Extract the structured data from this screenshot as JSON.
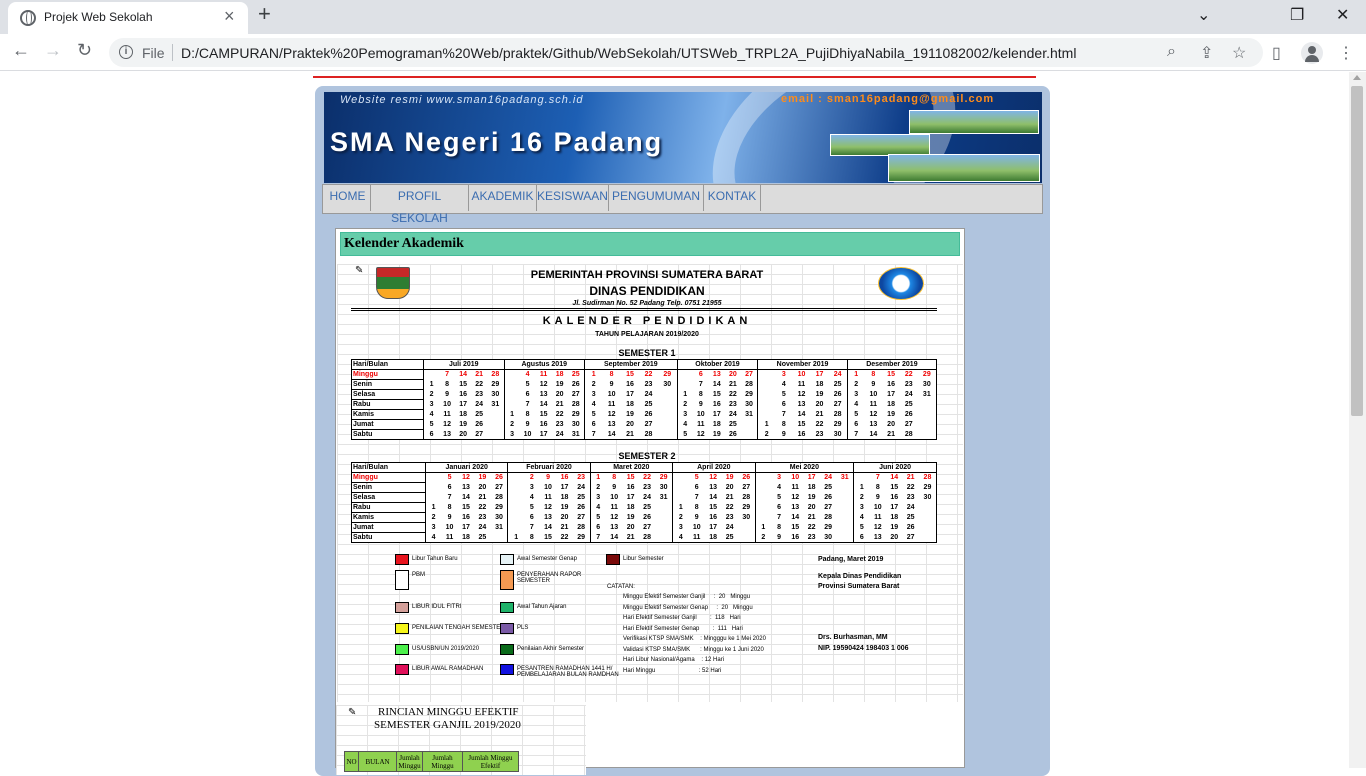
{
  "browser": {
    "tab_title": "Projek Web Sekolah",
    "file_label": "File",
    "url": "D:/CAMPURAN/Praktek%20Pemograman%20Web/praktek/Github/WebSekolah/UTSWeb_TRPL2A_PujiDhiyaNabila_1911082002/kelender.html"
  },
  "site": {
    "banner_web": "Website resmi www.sman16padang.sch.id",
    "banner_email": "email : sman16padang@gmail.com",
    "banner_school": "SMA Negeri 16 Padang",
    "menu": [
      "HOME",
      "PROFIL SEKOLAH",
      "AKADEMIK",
      "KESISWAAN",
      "PENGUMUMAN",
      "KONTAK"
    ],
    "section_heading": "Kelender Akademik"
  },
  "calendar": {
    "gov": "PEMERINTAH PROVINSI SUMATERA BARAT",
    "dept": "DINAS PENDIDIKAN",
    "address": "Jl. Sudirman No. 52 Padang Telp. 0751 21955",
    "title": "KALENDER PENDIDIKAN",
    "year": "TAHUN PELAJARAN 2019/2020",
    "day_col": "Hari/Bulan",
    "days": [
      "Minggu",
      "Senin",
      "Selasa",
      "Rabu",
      "Kamis",
      "Jumat",
      "Sabtu"
    ],
    "sem1": {
      "title": "SEMESTER 1",
      "months": [
        {
          "name": "Juli 2019",
          "cols": [
            [
              "",
              "1",
              "2",
              "3",
              "4",
              "5",
              "6"
            ],
            [
              "7",
              "8",
              "9",
              "10",
              "11",
              "12",
              "13"
            ],
            [
              "14",
              "15",
              "16",
              "17",
              "18",
              "19",
              "20"
            ],
            [
              "21",
              "22",
              "23",
              "24",
              "25",
              "26",
              "27"
            ],
            [
              "28",
              "29",
              "30",
              "31",
              "",
              "",
              ""
            ]
          ]
        },
        {
          "name": "Agustus 2019",
          "cols": [
            [
              "",
              "",
              "",
              "",
              "1",
              "2",
              "3"
            ],
            [
              "4",
              "5",
              "6",
              "7",
              "8",
              "9",
              "10"
            ],
            [
              "11",
              "12",
              "13",
              "14",
              "15",
              "16",
              "17"
            ],
            [
              "18",
              "19",
              "20",
              "21",
              "22",
              "23",
              "24"
            ],
            [
              "25",
              "26",
              "27",
              "28",
              "29",
              "30",
              "31"
            ]
          ]
        },
        {
          "name": "September 2019",
          "cols": [
            [
              "1",
              "2",
              "3",
              "4",
              "5",
              "6",
              "7"
            ],
            [
              "8",
              "9",
              "10",
              "11",
              "12",
              "13",
              "14"
            ],
            [
              "15",
              "16",
              "17",
              "18",
              "19",
              "20",
              "21"
            ],
            [
              "22",
              "23",
              "24",
              "25",
              "26",
              "27",
              "28"
            ],
            [
              "29",
              "30",
              "",
              "",
              "",
              "",
              ""
            ]
          ]
        },
        {
          "name": "Oktober 2019",
          "cols": [
            [
              "",
              "",
              "1",
              "2",
              "3",
              "4",
              "5"
            ],
            [
              "6",
              "7",
              "8",
              "9",
              "10",
              "11",
              "12"
            ],
            [
              "13",
              "14",
              "15",
              "16",
              "17",
              "18",
              "19"
            ],
            [
              "20",
              "21",
              "22",
              "23",
              "24",
              "25",
              "26"
            ],
            [
              "27",
              "28",
              "29",
              "30",
              "31",
              "",
              ""
            ]
          ]
        },
        {
          "name": "November 2019",
          "cols": [
            [
              "",
              "",
              "",
              "",
              "",
              "1",
              "2"
            ],
            [
              "3",
              "4",
              "5",
              "6",
              "7",
              "8",
              "9"
            ],
            [
              "10",
              "11",
              "12",
              "13",
              "14",
              "15",
              "16"
            ],
            [
              "17",
              "18",
              "19",
              "20",
              "21",
              "22",
              "23"
            ],
            [
              "24",
              "25",
              "26",
              "27",
              "28",
              "29",
              "30"
            ]
          ]
        },
        {
          "name": "Desember 2019",
          "cols": [
            [
              "1",
              "2",
              "3",
              "4",
              "5",
              "6",
              "7"
            ],
            [
              "8",
              "9",
              "10",
              "11",
              "12",
              "13",
              "14"
            ],
            [
              "15",
              "16",
              "17",
              "18",
              "19",
              "20",
              "21"
            ],
            [
              "22",
              "23",
              "24",
              "25",
              "26",
              "27",
              "28"
            ],
            [
              "29",
              "30",
              "31",
              "",
              "",
              "",
              ""
            ]
          ]
        }
      ]
    },
    "sem2": {
      "title": "SEMESTER 2",
      "months": [
        {
          "name": "Januari 2020",
          "cols": [
            [
              "",
              "",
              "",
              "1",
              "2",
              "3",
              "4"
            ],
            [
              "5",
              "6",
              "7",
              "8",
              "9",
              "10",
              "11"
            ],
            [
              "12",
              "13",
              "14",
              "15",
              "16",
              "17",
              "18"
            ],
            [
              "19",
              "20",
              "21",
              "22",
              "23",
              "24",
              "25"
            ],
            [
              "26",
              "27",
              "28",
              "29",
              "30",
              "31",
              ""
            ]
          ]
        },
        {
          "name": "Februari 2020",
          "cols": [
            [
              "",
              "",
              "",
              "",
              "",
              "",
              "1"
            ],
            [
              "2",
              "3",
              "4",
              "5",
              "6",
              "7",
              "8"
            ],
            [
              "9",
              "10",
              "11",
              "12",
              "13",
              "14",
              "15"
            ],
            [
              "16",
              "17",
              "18",
              "19",
              "20",
              "21",
              "22"
            ],
            [
              "23",
              "24",
              "25",
              "26",
              "27",
              "28",
              "29"
            ]
          ]
        },
        {
          "name": "Maret 2020",
          "cols": [
            [
              "1",
              "2",
              "3",
              "4",
              "5",
              "6",
              "7"
            ],
            [
              "8",
              "9",
              "10",
              "11",
              "12",
              "13",
              "14"
            ],
            [
              "15",
              "16",
              "17",
              "18",
              "19",
              "20",
              "21"
            ],
            [
              "22",
              "23",
              "24",
              "25",
              "26",
              "27",
              "28"
            ],
            [
              "29",
              "30",
              "31",
              "",
              "",
              "",
              ""
            ]
          ]
        },
        {
          "name": "April 2020",
          "cols": [
            [
              "",
              "",
              "",
              "1",
              "2",
              "3",
              "4"
            ],
            [
              "5",
              "6",
              "7",
              "8",
              "9",
              "10",
              "11"
            ],
            [
              "12",
              "13",
              "14",
              "15",
              "16",
              "17",
              "18"
            ],
            [
              "19",
              "20",
              "21",
              "22",
              "23",
              "24",
              "25"
            ],
            [
              "26",
              "27",
              "28",
              "29",
              "30",
              "",
              ""
            ]
          ]
        },
        {
          "name": "Mei 2020",
          "cols": [
            [
              "",
              "",
              "",
              "",
              "",
              "1",
              "2"
            ],
            [
              "3",
              "4",
              "5",
              "6",
              "7",
              "8",
              "9"
            ],
            [
              "10",
              "11",
              "12",
              "13",
              "14",
              "15",
              "16"
            ],
            [
              "17",
              "18",
              "19",
              "20",
              "21",
              "22",
              "23"
            ],
            [
              "24",
              "25",
              "26",
              "27",
              "28",
              "29",
              "30"
            ],
            [
              "31",
              "",
              "",
              "",
              "",
              "",
              ""
            ]
          ]
        },
        {
          "name": "Juni 2020",
          "cols": [
            [
              "",
              "1",
              "2",
              "3",
              "4",
              "5",
              "6"
            ],
            [
              "7",
              "8",
              "9",
              "10",
              "11",
              "12",
              "13"
            ],
            [
              "14",
              "15",
              "16",
              "17",
              "18",
              "19",
              "20"
            ],
            [
              "21",
              "22",
              "23",
              "24",
              "25",
              "26",
              "27"
            ],
            [
              "28",
              "29",
              "30",
              "",
              "",
              "",
              ""
            ]
          ]
        }
      ]
    },
    "legend": [
      {
        "label": "Libur Tahun Baru",
        "color": "#e8141e"
      },
      {
        "label": "Awal Semester Genap",
        "color": "#e6f2f5"
      },
      {
        "label": "Libur Semester",
        "color": "#7a0a0a"
      },
      {
        "label": "PBM",
        "color": "#ffffff"
      },
      {
        "label": "PENYERAHAN RAPOR SEMESTER",
        "color": "#f59a52"
      },
      {
        "label": "LIBUR IDUL FITRI",
        "color": "#d4a09a"
      },
      {
        "label": "Awal Tahun Ajaran",
        "color": "#1fb36a"
      },
      {
        "label": "PENILAIAN TENGAH SEMESTER",
        "color": "#f5f51a"
      },
      {
        "label": "PLS",
        "color": "#7a5aa6"
      },
      {
        "label": "US/USBN/UN 2019/2020",
        "color": "#4cf04c"
      },
      {
        "label": "Penilaian Akhir Semester",
        "color": "#0a6a1a"
      },
      {
        "label": "LIBUR AWAL RAMADHAN",
        "color": "#e0105a"
      },
      {
        "label": "PESANTREN RAMADHAN 1441 H/ PEMBELAJARAN BULAN RAMDHAN",
        "color": "#1212e0"
      }
    ],
    "catatan": "CATATAN:",
    "notes": [
      "Minggu Efektif Semester Ganjil     :  20   Minggu",
      "Minggu Efektif Semester Genap     :  20   Minggu",
      "Hari Efektif Semester Ganjil        :  118   Hari",
      "Hari Efektif Semester Genap        :  111   Hari",
      "Verifikasi KTSP SMA/SMK    : Mingggu ke 1 Mei 2020",
      "Validasi KTSP SMA/SMK      : Minggu ke 1 Juni 2020",
      "Hari Libur Nasional/Agama    : 12 Hari",
      "Hari Minggu                          : 52 Hari"
    ],
    "place_date": "Padang,     Maret 2019",
    "signer_title1": "Kepala Dinas Pendidikan",
    "signer_title2": "Provinsi Sumatera Barat",
    "signer_name": "Drs. Burhasman, MM",
    "signer_nip": "NIP. 19590424 198403 1 006"
  },
  "rincian": {
    "title1": "RINCIAN MINGGU EFEKTIF",
    "title2": "SEMESTER GANJIL 2019/2020",
    "headers": [
      "NO",
      "BULAN",
      "Jumlah Minggu",
      "Jumlah Minggu",
      "Jumlah Minggu Efektif"
    ]
  }
}
